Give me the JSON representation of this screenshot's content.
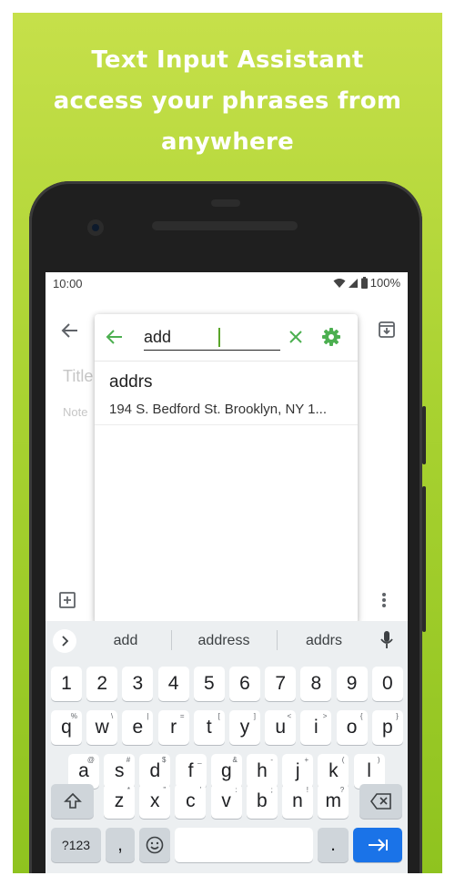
{
  "banner": {
    "headline_lines": [
      "Text Input Assistant",
      "access your phrases from",
      "anywhere"
    ],
    "bg_color": "#a9d231"
  },
  "status_bar": {
    "time": "10:00",
    "battery": "100%",
    "icons": [
      "wifi-icon",
      "signal-icon",
      "battery-icon"
    ]
  },
  "notes_app": {
    "title_placeholder": "Title",
    "note_placeholder": "Note",
    "icons": [
      "back-arrow-icon",
      "archive-icon",
      "add-box-icon",
      "more-vert-icon"
    ]
  },
  "popup": {
    "search": {
      "value": "add",
      "icons": [
        "back-arrow-icon",
        "clear-icon",
        "gear-icon"
      ],
      "accent_color": "#4caf50"
    },
    "results": [
      {
        "title": "addrs",
        "text": "194 S. Bedford St. Brooklyn, NY 1..."
      }
    ]
  },
  "keyboard": {
    "suggestions": [
      "add",
      "address",
      "addrs"
    ],
    "rows": [
      {
        "keys": [
          {
            "label": "1"
          },
          {
            "label": "2"
          },
          {
            "label": "3"
          },
          {
            "label": "4"
          },
          {
            "label": "5"
          },
          {
            "label": "6"
          },
          {
            "label": "7"
          },
          {
            "label": "8"
          },
          {
            "label": "9"
          },
          {
            "label": "0"
          }
        ]
      },
      {
        "keys": [
          {
            "label": "q",
            "hint": "%"
          },
          {
            "label": "w",
            "hint": "\\"
          },
          {
            "label": "e",
            "hint": "|"
          },
          {
            "label": "r",
            "hint": "="
          },
          {
            "label": "t",
            "hint": "["
          },
          {
            "label": "y",
            "hint": "]"
          },
          {
            "label": "u",
            "hint": "<"
          },
          {
            "label": "i",
            "hint": ">"
          },
          {
            "label": "o",
            "hint": "{"
          },
          {
            "label": "p",
            "hint": "}"
          }
        ]
      },
      {
        "keys": [
          {
            "label": "a",
            "hint": "@"
          },
          {
            "label": "s",
            "hint": "#"
          },
          {
            "label": "d",
            "hint": "$"
          },
          {
            "label": "f",
            "hint": "_"
          },
          {
            "label": "g",
            "hint": "&"
          },
          {
            "label": "h",
            "hint": "-"
          },
          {
            "label": "j",
            "hint": "+"
          },
          {
            "label": "k",
            "hint": "("
          },
          {
            "label": "l",
            "hint": ")"
          }
        ]
      },
      {
        "keys": [
          {
            "label": "z",
            "hint": "*"
          },
          {
            "label": "x",
            "hint": "\""
          },
          {
            "label": "c",
            "hint": "'"
          },
          {
            "label": "v",
            "hint": ":"
          },
          {
            "label": "b",
            "hint": ";"
          },
          {
            "label": "n",
            "hint": "!"
          },
          {
            "label": "m",
            "hint": "?"
          }
        ]
      }
    ],
    "symbols_label": "?123",
    "comma_label": ",",
    "period_label": ".",
    "enter_color": "#1a73e8",
    "icons": [
      "expand-icon",
      "mic-icon",
      "shift-icon",
      "backspace-icon",
      "emoji-icon",
      "enter-icon"
    ]
  }
}
